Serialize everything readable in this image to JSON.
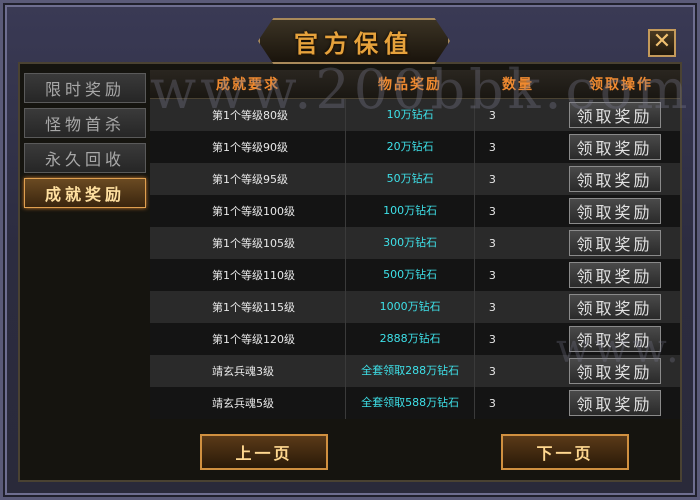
{
  "window": {
    "title": "官方保值",
    "close_label": "✕"
  },
  "tabs": [
    {
      "label": "限时奖励",
      "active": false
    },
    {
      "label": "怪物首杀",
      "active": false
    },
    {
      "label": "永久回收",
      "active": false
    },
    {
      "label": "成就奖励",
      "active": true
    }
  ],
  "table": {
    "headers": [
      "成就要求",
      "物品奖励",
      "数量",
      "领取操作"
    ],
    "rows": [
      {
        "requirement": "第1个等级80级",
        "reward": "10万钻石",
        "qty": "3",
        "action": "领取奖励"
      },
      {
        "requirement": "第1个等级90级",
        "reward": "20万钻石",
        "qty": "3",
        "action": "领取奖励"
      },
      {
        "requirement": "第1个等级95级",
        "reward": "50万钻石",
        "qty": "3",
        "action": "领取奖励"
      },
      {
        "requirement": "第1个等级100级",
        "reward": "100万钻石",
        "qty": "3",
        "action": "领取奖励"
      },
      {
        "requirement": "第1个等级105级",
        "reward": "300万钻石",
        "qty": "3",
        "action": "领取奖励"
      },
      {
        "requirement": "第1个等级110级",
        "reward": "500万钻石",
        "qty": "3",
        "action": "领取奖励"
      },
      {
        "requirement": "第1个等级115级",
        "reward": "1000万钻石",
        "qty": "3",
        "action": "领取奖励"
      },
      {
        "requirement": "第1个等级120级",
        "reward": "2888万钻石",
        "qty": "3",
        "action": "领取奖励"
      },
      {
        "requirement": "靖玄兵魂3级",
        "reward": "全套领取288万钻石",
        "qty": "3",
        "action": "领取奖励"
      },
      {
        "requirement": "靖玄兵魂5级",
        "reward": "全套领取588万钻石",
        "qty": "3",
        "action": "领取奖励"
      }
    ]
  },
  "pager": {
    "prev_label": "上一页",
    "next_label": "下一页"
  },
  "watermark": {
    "text": "www.200bbk.com",
    "text2": "www."
  },
  "colors": {
    "accent_orange": "#f08a30",
    "reward_cyan": "#3ee0e8",
    "title_gold": "#e6a23c"
  }
}
